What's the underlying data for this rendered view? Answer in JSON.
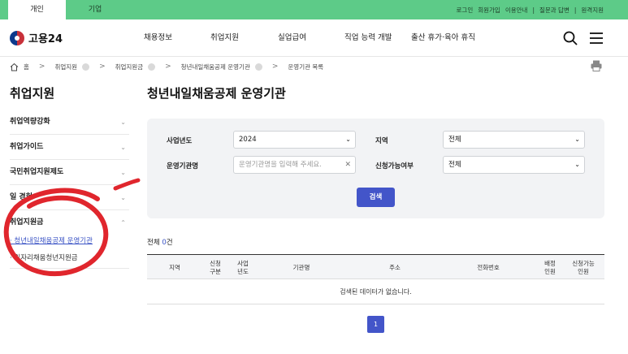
{
  "top_tabs": [
    "개인",
    "기업"
  ],
  "top_links": [
    "로그인",
    "회원가입",
    "이용안내",
    "질문과 답변",
    "원격지원"
  ],
  "top_link_separators": [
    "|",
    "|",
    "|"
  ],
  "logo": {
    "text": "고용24"
  },
  "gnb": [
    "채용정보",
    "취업지원",
    "실업급여",
    "직업 능력 개발",
    "출산 휴가·육아 휴직"
  ],
  "header_icons": [
    "search-icon",
    "menu-icon"
  ],
  "breadcrumb": [
    "홈",
    "취업지원",
    "취업지원금",
    "청년내일채움공제 운영기관",
    "운영기관 목록"
  ],
  "breadcrumb_separator": ">",
  "sidebar": {
    "title": "취업지원",
    "items": [
      {
        "label": "취업역량강화",
        "chevron": "⌄"
      },
      {
        "label": "취업가이드",
        "chevron": "⌄"
      },
      {
        "label": "국민취업지원제도",
        "chevron": "⌄"
      },
      {
        "label": "일 경험",
        "chevron": "⌄"
      },
      {
        "label": "취업지원금",
        "chevron": "⌃"
      }
    ],
    "sub_items": [
      "· 청년내일채움공제 운영기관",
      "· 일자리채움청년지원금"
    ]
  },
  "main": {
    "title": "청년내일채움공제 운영기관",
    "filters": {
      "year_label": "사업년도",
      "year_value": "2024",
      "region_label": "지역",
      "region_value": "전체",
      "org_label": "운영기관명",
      "org_placeholder": "운영기관명을 입력해 주세요.",
      "apply_label": "신청가능여부",
      "apply_value": "전체",
      "search_button": "검색"
    },
    "total_prefix": "전체 ",
    "total_count": "0",
    "total_suffix": "건",
    "table_headers": [
      "지역",
      "신청\n구분",
      "사업\n년도",
      "기관명",
      "주소",
      "전화번호",
      "배정\n인원",
      "신청가능\n인원"
    ],
    "empty_message": "검색된 데이터가 없습니다.",
    "page": "1"
  },
  "colors": {
    "topbar": "#5dcb88",
    "accent": "#4355c9",
    "annotation": "#e0262d"
  }
}
